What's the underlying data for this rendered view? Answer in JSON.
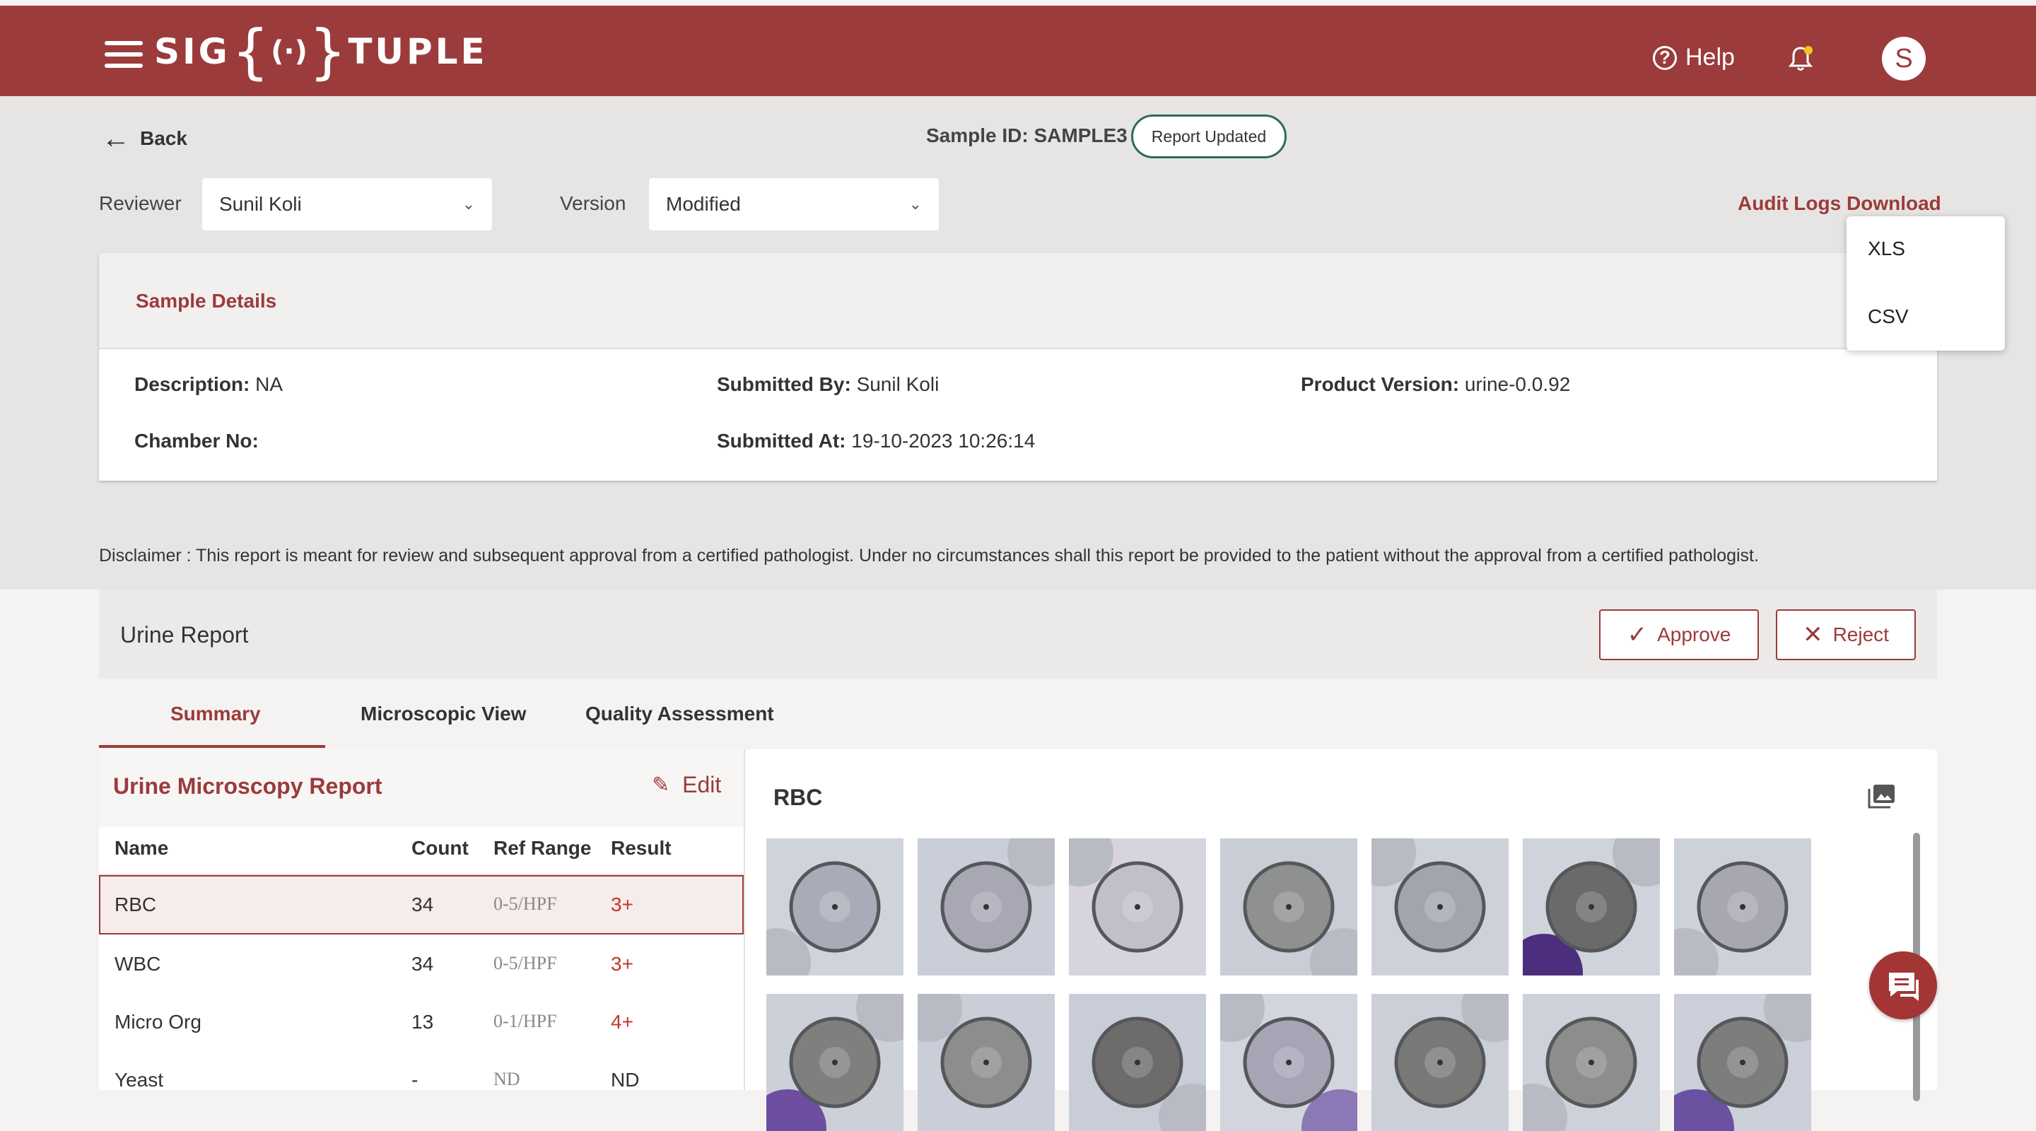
{
  "header": {
    "logo_text_left": "SIG",
    "logo_text_right": "TUPLE",
    "help_label": "Help",
    "avatar_initial": "S",
    "brand_color": "#9b3b3b"
  },
  "toolbar": {
    "back_label": "Back",
    "sample_id": "Sample ID: SAMPLE3",
    "status_badge": "Report Updated",
    "reviewer_label": "Reviewer",
    "reviewer_value": "Sunil Koli",
    "version_label": "Version",
    "version_value": "Modified",
    "audit_logs_label": "Audit Logs",
    "download_label": "Download",
    "download_options": [
      "XLS",
      "CSV"
    ]
  },
  "sample_details": {
    "title": "Sample Details",
    "description_key": "Description:",
    "description_value": "NA",
    "submitted_by_key": "Submitted By:",
    "submitted_by_value": "Sunil Koli",
    "product_version_key": "Product Version:",
    "product_version_value": "urine-0.0.92",
    "chamber_key": "Chamber No:",
    "chamber_value": "",
    "submitted_at_key": "Submitted At:",
    "submitted_at_value": "19-10-2023 10:26:14"
  },
  "disclaimer": "Disclaimer :  This report is meant for review and subsequent approval from a certified pathologist. Under no circumstances shall this report be provided to the patient without the approval from a certified pathologist.",
  "report": {
    "title": "Urine Report",
    "approve_label": "Approve",
    "reject_label": "Reject",
    "tabs": [
      "Summary",
      "Microscopic View",
      "Quality Assessment"
    ],
    "active_tab": "Summary"
  },
  "microscopy": {
    "title": "Urine Microscopy Report",
    "edit_label": "Edit",
    "columns": [
      "Name",
      "Count",
      "Ref Range",
      "Result"
    ],
    "rows": [
      {
        "name": "RBC",
        "count": "34",
        "ref": "0-5/HPF",
        "result": "3+"
      },
      {
        "name": "WBC",
        "count": "34",
        "ref": "0-5/HPF",
        "result": "3+"
      },
      {
        "name": "Micro Org",
        "count": "13",
        "ref": "0-1/HPF",
        "result": "4+"
      },
      {
        "name": "Yeast",
        "count": "-",
        "ref": "ND",
        "result": "ND"
      }
    ],
    "selected_row": "RBC"
  },
  "gallery": {
    "title": "RBC",
    "icon": "gallery-icon",
    "cells": [
      {
        "bg": "#cfd4dc",
        "cell": "#a9acb8",
        "stain": "none"
      },
      {
        "bg": "#c9ced8",
        "cell": "#a7a8b3",
        "stain": "none"
      },
      {
        "bg": "#d8d4df",
        "cell": "#c1bfca",
        "stain": "none"
      },
      {
        "bg": "#c8cdd6",
        "cell": "#8f9190",
        "stain": "none"
      },
      {
        "bg": "#cdd2da",
        "cell": "#a2a5ae",
        "stain": "none"
      },
      {
        "bg": "#cfd3db",
        "cell": "#6b6a6a",
        "stain": "#4b2f7e"
      },
      {
        "bg": "#cdd1da",
        "cell": "#a6a7b1",
        "stain": "none"
      },
      {
        "bg": "#cbd0d9",
        "cell": "#7f807e",
        "stain": "#6e4ea0"
      },
      {
        "bg": "#c9ced8",
        "cell": "#8c8d8c",
        "stain": "none"
      },
      {
        "bg": "#c8cdd7",
        "cell": "#6d6c6a",
        "stain": "none"
      },
      {
        "bg": "#d3d5de",
        "cell": "#a7a4b6",
        "stain": "#8b78b5"
      },
      {
        "bg": "#cbd0d8",
        "cell": "#787976",
        "stain": "none"
      },
      {
        "bg": "#cdd1da",
        "cell": "#8d8e8c",
        "stain": "none"
      },
      {
        "bg": "#cbcfd9",
        "cell": "#7d7e7c",
        "stain": "#6a52a0"
      }
    ]
  }
}
